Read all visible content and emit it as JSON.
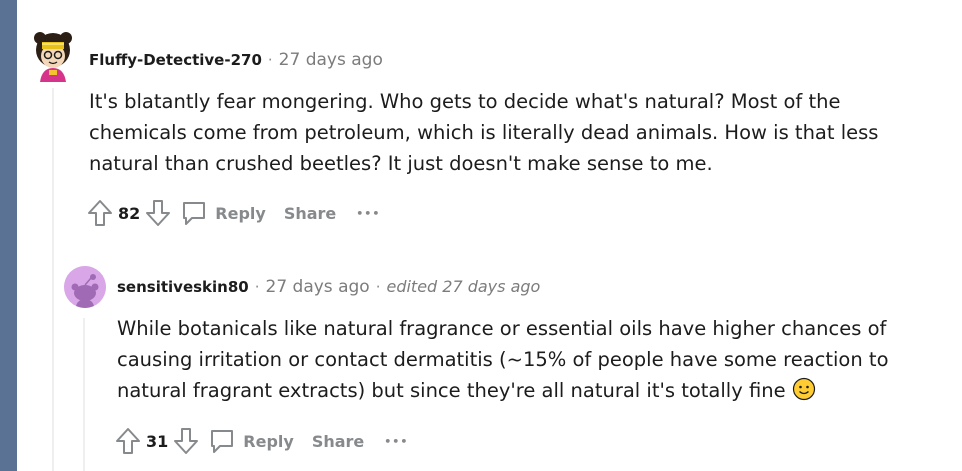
{
  "comments": [
    {
      "author": "Fluffy-Detective-270",
      "time": "27 days ago",
      "body": "It's blatantly fear mongering. Who gets to decide what's natural? Most of the chemicals come from petroleum, which is literally dead animals. How is that less natural than crushed beetles? It just doesn't make sense to me.",
      "score": "82",
      "reply_label": "Reply",
      "share_label": "Share",
      "more_label": "•••"
    },
    {
      "author": "sensitiveskin80",
      "time": "27 days ago",
      "edited": "edited 27 days ago",
      "body": "While botanicals like natural fragrance or essential oils have higher chances of causing irritation or contact dermatitis (~15% of people have some reaction to natural fragrant extracts) but since they're all natural it's totally fine",
      "emoji": "slightly-smiling-face",
      "score": "31",
      "reply_label": "Reply",
      "share_label": "Share",
      "more_label": "•••"
    }
  ],
  "colors": {
    "left_strip": "#5a7394",
    "thread_line": "#edeff1",
    "meta_gray": "#7c7c7c",
    "action_gray": "#878a8c",
    "avatar2_bg": "#d9a7e8"
  }
}
